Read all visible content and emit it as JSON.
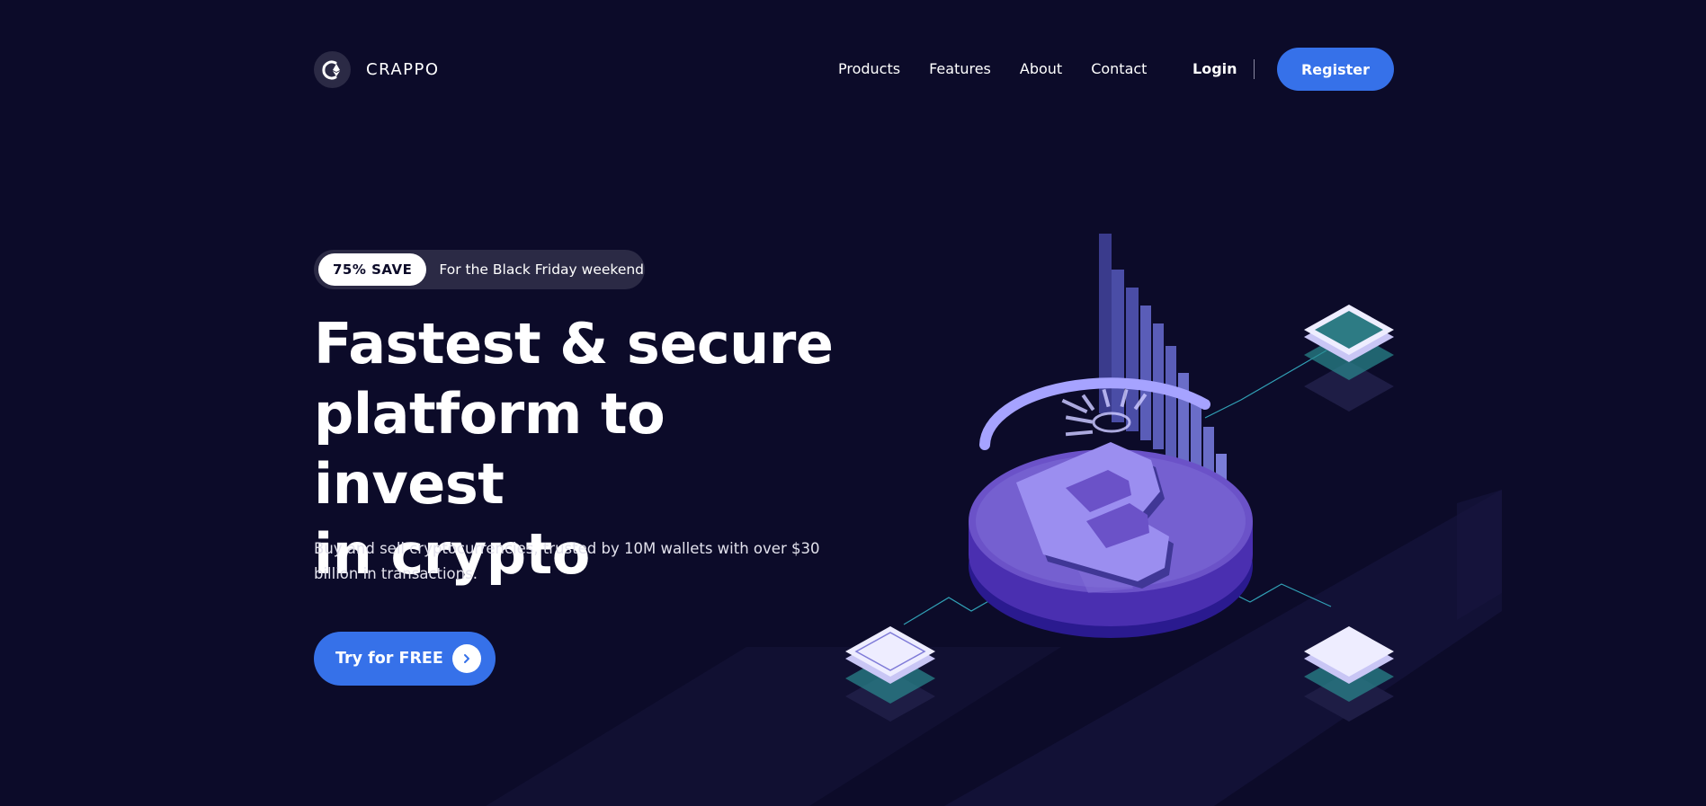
{
  "brand": {
    "name": "CRAPPO",
    "logo_icon": "ethereum-c-logo-icon"
  },
  "nav": {
    "items": [
      {
        "label": "Products"
      },
      {
        "label": "Features"
      },
      {
        "label": "About"
      },
      {
        "label": "Contact"
      }
    ],
    "login_label": "Login",
    "register_label": "Register"
  },
  "hero": {
    "badge": "75% SAVE",
    "badge_text": "For the Black Friday weekend",
    "headline": [
      "Fastest & secure",
      "platform to invest",
      "in crypto"
    ],
    "subtitle": "Buy and sell cryptocurrencies, trusted by 10M wallets with over $30 billion in transactions.",
    "cta_label": "Try for FREE",
    "cta_icon": "chevron-right-icon"
  },
  "illustration": {
    "name": "isometric-bitcoin-coin-illustration",
    "icon": "bitcoin-icon"
  },
  "colors": {
    "background": "#0c0b29",
    "accent": "#3671e9",
    "pill": "#2b2a45",
    "coin": "#6b52c8"
  }
}
